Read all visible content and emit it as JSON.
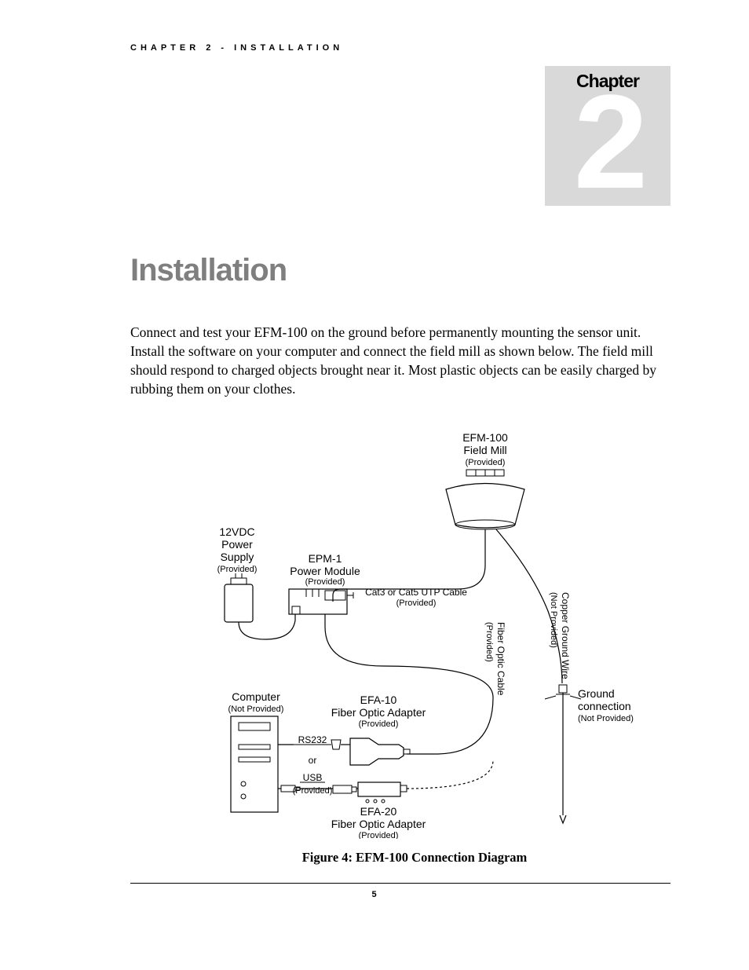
{
  "header": {
    "running": "CHAPTER 2 - INSTALLATION"
  },
  "chapter": {
    "label": "Chapter",
    "number": "2"
  },
  "title": "Installation",
  "intro": "Connect and test your EFM-100 on the ground before permanently mounting the sensor unit.  Install the software on your computer and connect the field mill as shown below.  The field mill should respond to charged objects brought near it.  Most plastic objects can be easily charged by rubbing them on your clothes.",
  "figure": {
    "caption": "Figure 4:  EFM-100 Connection Diagram",
    "labels": {
      "efm100_title": "EFM-100",
      "efm100_sub": "Field Mill",
      "efm100_note": "(Provided)",
      "psu_l1": "12VDC",
      "psu_l2": "Power",
      "psu_l3": "Supply",
      "psu_note": "(Provided)",
      "epm1_title": "EPM-1",
      "epm1_sub": "Power Module",
      "epm1_note": "(Provided)",
      "cat_cable": "Cat3 or Cat5 UTP Cable",
      "cat_note": "(Provided)",
      "fiber_cable": "Fiber Optic Cable",
      "fiber_note": "(Provided)",
      "ground_wire": "Copper Ground Wire",
      "ground_wire_note": "(Not Provided)",
      "computer": "Computer",
      "computer_note": "(Not Provided)",
      "efa10_title": "EFA-10",
      "efa10_sub": "Fiber Optic Adapter",
      "efa10_note": "(Provided)",
      "rs232": "RS232",
      "or": "or",
      "usb": "USB",
      "usb_note": "(Provided)",
      "efa20_title": "EFA-20",
      "efa20_sub": "Fiber Optic Adapter",
      "efa20_note": "(Provided)",
      "ground_title": "Ground",
      "ground_sub": "connection",
      "ground_note": "(Not Provided)"
    }
  },
  "page": "5"
}
